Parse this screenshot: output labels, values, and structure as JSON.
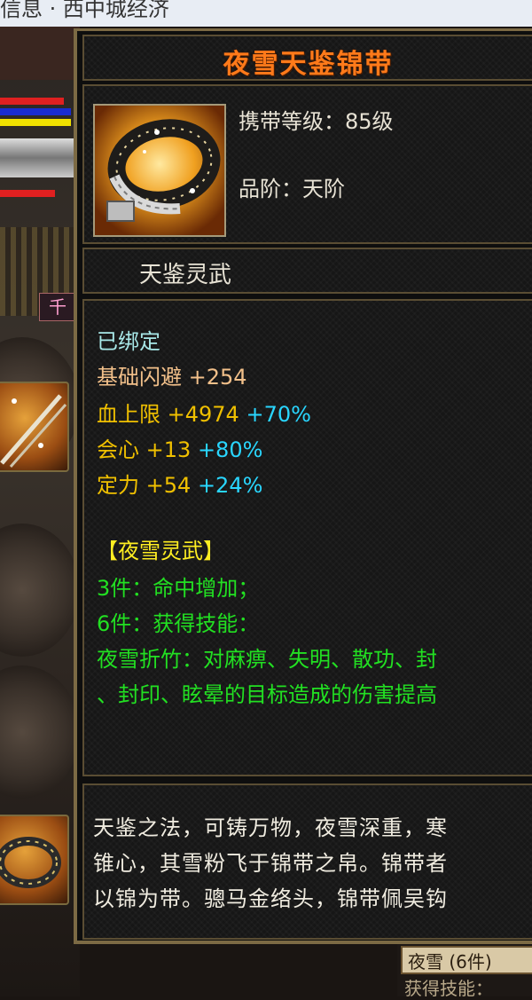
{
  "window": {
    "title_fragment": "信息 · 西中城经济"
  },
  "tooltip": {
    "item_name": "夜雪天鉴锦带",
    "carry_level": {
      "label": "携带等级：",
      "value": "85级"
    },
    "grade": {
      "label": "品阶：",
      "value": "天阶"
    },
    "set_name": "天鉴灵武",
    "bound": "已绑定",
    "base_stat": {
      "name": "基础闪避",
      "value": "+254"
    },
    "stats": [
      {
        "name": "血上限",
        "value": "+4974",
        "pct": "+70%"
      },
      {
        "name": "会心",
        "value": "+13",
        "pct": "+80%"
      },
      {
        "name": "定力",
        "value": "+54",
        "pct": "+24%"
      }
    ],
    "set_bonus": {
      "title": "【夜雪灵武】",
      "lines": [
        "3件：命中增加；",
        "6件：获得技能：",
        "夜雪折竹：对麻痹、失明、散功、封",
        "、封印、眩晕的目标造成的伤害提高"
      ]
    },
    "description": [
      "天鉴之法，可铸万物，夜雪深重，寒",
      "锥心，其雪粉飞于锦带之帛。锦带者",
      "以锦为带。骢马金络头，锦带佩吴钩"
    ]
  },
  "background": {
    "side_tag": "千",
    "bottom_fragment_1": "夜雪 (6件)",
    "bottom_fragment_2": "获得技能："
  },
  "colors": {
    "item_name": "#ff7a1a",
    "bound": "#a8e8e8",
    "base_stat": "#f2c08a",
    "attr": "#f0c000",
    "percent": "#29d6ff",
    "set_title": "#ffee22",
    "set_lines": "#22e022",
    "frame": "#7c6a44"
  },
  "icons": [
    "belt-item-icon",
    "weapon-slot-icon",
    "belt-slot-icon"
  ]
}
